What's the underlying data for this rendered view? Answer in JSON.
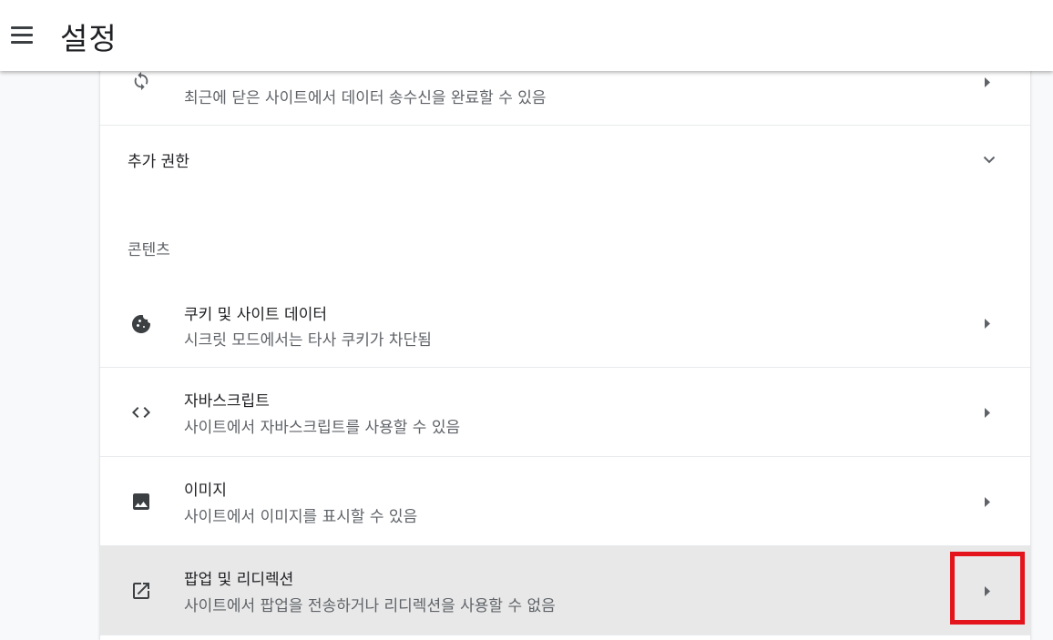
{
  "header": {
    "title": "설정"
  },
  "rows": {
    "background_sync": {
      "subtitle": "최근에 닫은 사이트에서 데이터 송수신을 완료할 수 있음"
    },
    "additional_permissions": {
      "label": "추가 권한"
    },
    "content_section": {
      "label": "콘텐츠"
    },
    "cookies": {
      "title": "쿠키 및 사이트 데이터",
      "subtitle": "시크릿 모드에서는 타사 쿠키가 차단됨"
    },
    "javascript": {
      "title": "자바스크립트",
      "subtitle": "사이트에서 자바스크립트를 사용할 수 있음"
    },
    "images": {
      "title": "이미지",
      "subtitle": "사이트에서 이미지를 표시할 수 있음"
    },
    "popups": {
      "title": "팝업 및 리디렉션",
      "subtitle": "사이트에서 팝업을 전송하거나 리디렉션을 사용할 수 없음"
    }
  },
  "colors": {
    "highlight_box": "#e4141c",
    "hovered_row": "#e8e8e8"
  },
  "icons": {
    "menu": "menu-icon",
    "sync": "sync-icon",
    "cookie": "cookie-icon",
    "code": "code-icon",
    "image": "image-icon",
    "open_in_new": "open-in-new-icon",
    "chevron_down": "chevron-down-icon",
    "arrow_right": "arrow-right-icon"
  }
}
